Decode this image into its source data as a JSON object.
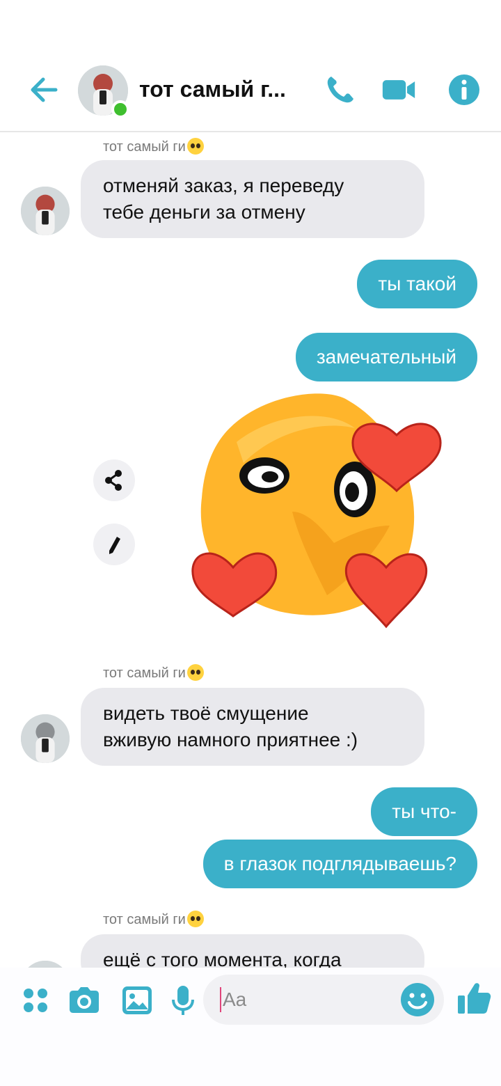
{
  "header": {
    "contact_name": "тот самый г...",
    "online": true,
    "icons": [
      "back-arrow-icon",
      "phone-icon",
      "video-camera-icon",
      "info-icon"
    ]
  },
  "messages": {
    "sender_label": "тот самый ги",
    "m1": {
      "line1": "отменяй заказ, я переведу",
      "line2": "тебе деньги за отмену"
    },
    "m2": "ты такой",
    "m3": "замечательный",
    "sticker": "blushing-hearts-emoji-sticker",
    "m4": {
      "line1": "видеть твоё смущение",
      "line2": "вживую намного приятнее :)"
    },
    "m5": "ты что-",
    "m6": "в глазок подглядываешь?",
    "m7": "ещё с того момента, когда"
  },
  "composer": {
    "placeholder": "Aa",
    "icons": [
      "apps-icon",
      "camera-icon",
      "gallery-icon",
      "microphone-icon",
      "emoji-icon",
      "thumbs-up-icon"
    ]
  },
  "colors": {
    "accent": "#3bb0c9",
    "incoming_bubble": "#e9e9ed",
    "online": "#3fbf2f"
  }
}
